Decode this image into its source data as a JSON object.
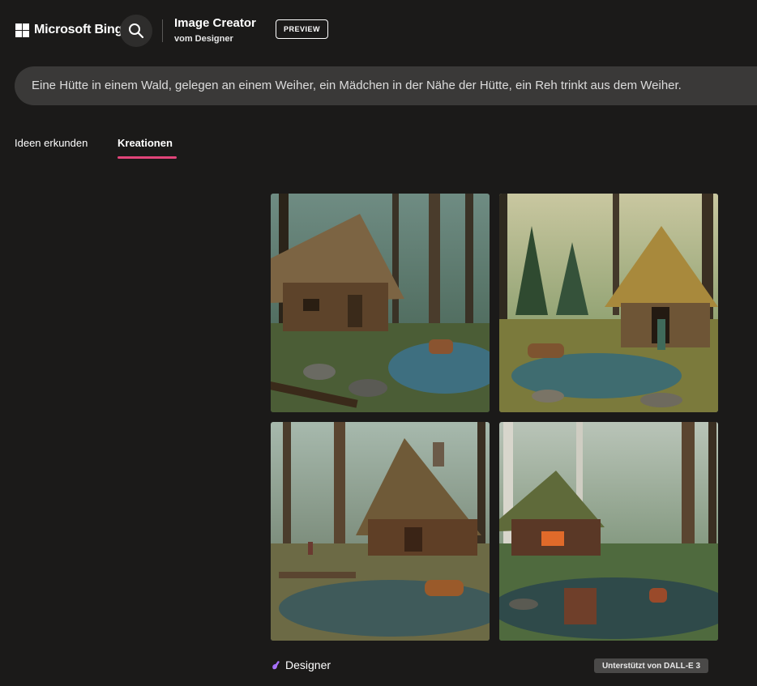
{
  "header": {
    "brand": "Microsoft Bing",
    "brand_icon": "microsoft-logo-icon",
    "search_icon": "search-icon",
    "title": "Image Creator",
    "subtitle": "vom Designer",
    "badge": "PREVIEW"
  },
  "prompt": {
    "text": "Eine Hütte in einem Wald, gelegen an einem Weiher, ein Mädchen in der Nähe der Hütte, ein Reh trinkt aus dem Weiher."
  },
  "tabs": [
    {
      "label": "Ideen erkunden",
      "active": false
    },
    {
      "label": "Kreationen",
      "active": true
    }
  ],
  "footer": {
    "designer_label": "Designer",
    "designer_icon": "designer-logo-icon",
    "powered_by": "Unterstützt von DALL-E 3"
  },
  "colors": {
    "background": "#1b1a19",
    "prompt_bar": "#3a3938",
    "tab_underline": "#e2457a",
    "badge_bg": "#4a4948"
  }
}
